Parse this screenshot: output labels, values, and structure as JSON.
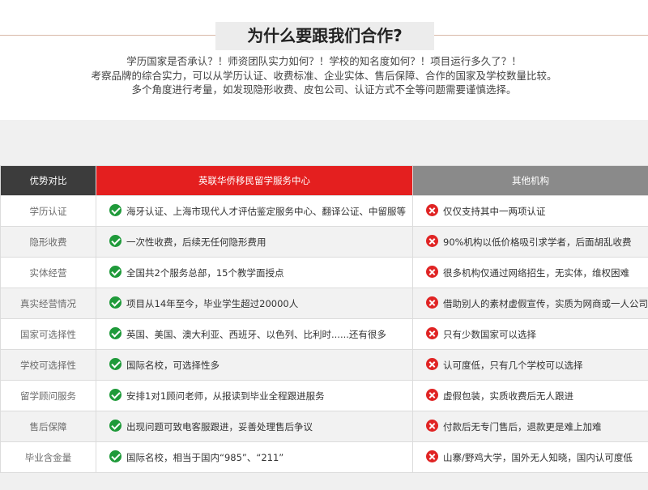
{
  "title": "为什么要跟我们合作?",
  "intro": [
    "学历国家是否承认？！师资团队实力如何？！学校的知名度如何？！项目运行多久了？！",
    "考察品牌的综合实力，可以从学历认证、收费标准、企业实体、售后保障、合作的国家及学校数量比较。",
    "多个角度进行考量，如发现隐形收费、皮包公司、认证方式不全等问题需要谨慎选择。"
  ],
  "table": {
    "headers": [
      "优势对比",
      "英联华侨移民留学服务中心",
      "其他机构"
    ],
    "rows": [
      {
        "label": "学历认证",
        "ours": "海牙认证、上海市现代人才评估鉴定服务中心、翻译公证、中留服等",
        "others": "仅仅支持其中一两项认证"
      },
      {
        "label": "隐形收费",
        "ours": "一次性收费，后续无任何隐形费用",
        "others": "90%机构以低价格吸引求学者，后面胡乱收费"
      },
      {
        "label": "实体经营",
        "ours": "全国共2个服务总部，15个教学面授点",
        "others": "很多机构仅通过网络招生，无实体，维权困难"
      },
      {
        "label": "真实经营情况",
        "ours": "项目从14年至今，毕业学生超过20000人",
        "others": "借助别人的素材虚假宣传，实质为网商或一人公司"
      },
      {
        "label": "国家可选择性",
        "ours": "英国、美国、澳大利亚、西班牙、以色列、比利时......还有很多",
        "others": "只有少数国家可以选择"
      },
      {
        "label": "学校可选择性",
        "ours": "国际名校，可选择性多",
        "others": "认可度低，只有几个学校可以选择"
      },
      {
        "label": "留学顾问服务",
        "ours": "安排1对1顾问老师，从报读到毕业全程跟进服务",
        "others": "虚假包装，实质收费后无人跟进"
      },
      {
        "label": "售后保障",
        "ours": "出现问题可致电客服跟进，妥善处理售后争议",
        "others": "付款后无专门售后，退款更是难上加难"
      },
      {
        "label": "毕业含金量",
        "ours": "国际名校，相当于国内“985”、“211”",
        "others": "山寨/野鸡大学，国外无人知晓，国内认可度低"
      }
    ]
  },
  "colors": {
    "accent_red": "#e41f1f",
    "check_green": "#1f9a3a",
    "header_dark": "#3c3c3c",
    "header_gray": "#8a8a8a"
  },
  "icons": {
    "ours": "check-icon",
    "others": "cross-icon"
  }
}
